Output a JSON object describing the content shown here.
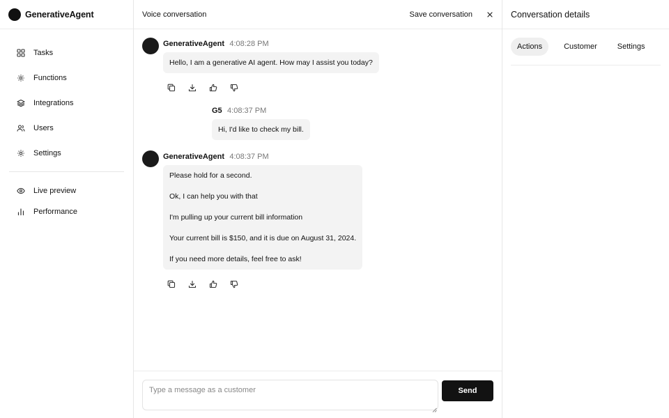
{
  "brand": {
    "name": "GenerativeAgent"
  },
  "sidebar": {
    "items": [
      {
        "label": "Tasks",
        "icon": "grid-icon"
      },
      {
        "label": "Functions",
        "icon": "gear-icon"
      },
      {
        "label": "Integrations",
        "icon": "layers-icon"
      },
      {
        "label": "Users",
        "icon": "users-icon"
      },
      {
        "label": "Settings",
        "icon": "gear-icon"
      }
    ],
    "secondary": [
      {
        "label": "Live preview",
        "icon": "eye-icon"
      },
      {
        "label": "Performance",
        "icon": "bar-chart-icon"
      }
    ]
  },
  "conversation": {
    "title": "Voice conversation",
    "save_label": "Save conversation",
    "messages": [
      {
        "sender": "GenerativeAgent",
        "time": "4:08:28 PM",
        "lines": [
          "Hello, I am a generative AI agent. How may I assist you today?"
        ]
      },
      {
        "sender": "G5",
        "time": "4:08:37 PM",
        "lines": [
          "Hi, I'd like to check my bill."
        ]
      },
      {
        "sender": "GenerativeAgent",
        "time": "4:08:37 PM",
        "lines": [
          "Please hold for a second.",
          "Ok, I can help you with that",
          "I'm pulling up your current bill information",
          "Your current bill is $150, and it is due on August 31, 2024.",
          "If you need more details, feel free to ask!"
        ]
      }
    ],
    "composer": {
      "placeholder": "Type a message as a customer",
      "send_label": "Send"
    }
  },
  "details": {
    "title": "Conversation details",
    "tabs": [
      {
        "label": "Actions",
        "active": true
      },
      {
        "label": "Customer",
        "active": false
      },
      {
        "label": "Settings",
        "active": false
      }
    ]
  },
  "colors": {
    "accent": "#121212",
    "bubble": "#f3f3f3",
    "border": "#e6e6e6"
  }
}
